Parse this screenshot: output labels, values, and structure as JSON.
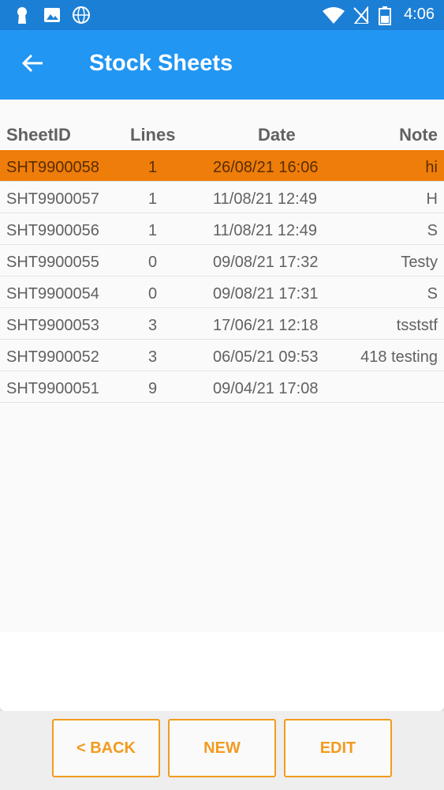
{
  "status_bar": {
    "time": "4:06",
    "icons": [
      "keyhole-notification-icon",
      "image-notification-icon",
      "globe-notification-icon",
      "wifi-icon",
      "no-signal-icon",
      "battery-icon"
    ]
  },
  "app_bar": {
    "title": "Stock Sheets",
    "back_icon": "arrow-left-icon"
  },
  "table": {
    "headers": {
      "sheet_id": "SheetID",
      "lines": "Lines",
      "date": "Date",
      "note": "Note"
    },
    "rows": [
      {
        "sheet_id": "SHT9900058",
        "lines": "1",
        "date": "26/08/21 16:06",
        "note": "hi",
        "selected": true
      },
      {
        "sheet_id": "SHT9900057",
        "lines": "1",
        "date": "11/08/21 12:49",
        "note": "H"
      },
      {
        "sheet_id": "SHT9900056",
        "lines": "1",
        "date": "11/08/21 12:49",
        "note": "S"
      },
      {
        "sheet_id": "SHT9900055",
        "lines": "0",
        "date": "09/08/21 17:32",
        "note": "Testy"
      },
      {
        "sheet_id": "SHT9900054",
        "lines": "0",
        "date": "09/08/21 17:31",
        "note": "S"
      },
      {
        "sheet_id": "SHT9900053",
        "lines": "3",
        "date": "17/06/21 12:18",
        "note": "tsststf"
      },
      {
        "sheet_id": "SHT9900052",
        "lines": "3",
        "date": "06/05/21 09:53",
        "note": "418 testing"
      },
      {
        "sheet_id": "SHT9900051",
        "lines": "9",
        "date": "09/04/21 17:08",
        "note": ""
      }
    ]
  },
  "buttons": {
    "back": "< BACK",
    "new": "NEW",
    "edit": "EDIT"
  },
  "colors": {
    "status_bar": "#1c7fd6",
    "app_bar": "#2196f3",
    "selected_row": "#ef7d0a",
    "button_accent": "#f29b1f"
  }
}
